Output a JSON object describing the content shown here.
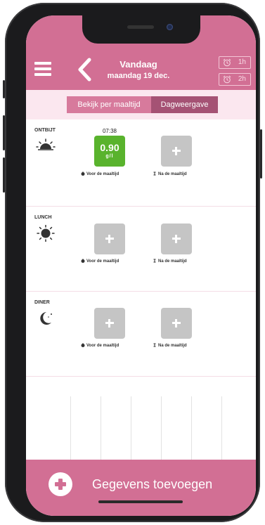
{
  "header": {
    "title": "Vandaag",
    "date": "maandag 19 dec.",
    "alarms": [
      {
        "label": "1h"
      },
      {
        "label": "2h"
      }
    ]
  },
  "view_toggle": {
    "per_meal": "Bekijk per maaltijd",
    "day_view": "Dagweergave"
  },
  "meals": [
    {
      "name": "ONTBIJT",
      "icon": "sunrise-icon",
      "before": {
        "time": "07:38",
        "value": "0.90",
        "unit": "g/l",
        "caption": "Voor de maaltijd"
      },
      "after": {
        "caption": "Na de maaltijd"
      }
    },
    {
      "name": "LUNCH",
      "icon": "sun-icon",
      "before": {
        "caption": "Voor de maaltijd"
      },
      "after": {
        "caption": "Na de maaltijd"
      }
    },
    {
      "name": "DINER",
      "icon": "moon-icon",
      "before": {
        "caption": "Voor de maaltijd"
      },
      "after": {
        "caption": "Na de maaltijd"
      }
    }
  ],
  "footer": {
    "add_label": "Gegevens toevoegen"
  },
  "colors": {
    "brand": "#d26f94",
    "value_ok": "#59b32d",
    "empty_tile": "#c5c5c5"
  }
}
